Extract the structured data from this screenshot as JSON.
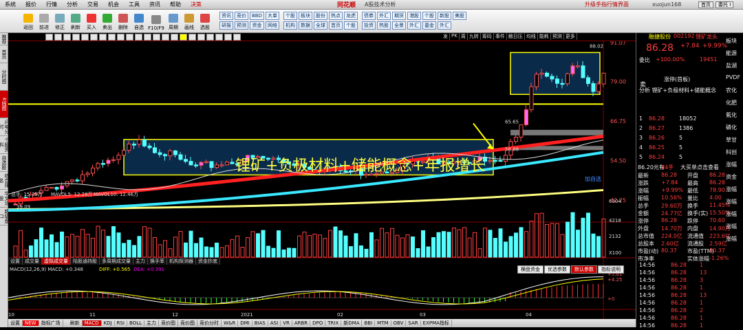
{
  "menu": {
    "items": [
      "系统",
      "报价",
      "行情",
      "分析",
      "交易",
      "机会",
      "工具",
      "资讯",
      "帮助",
      "决策"
    ],
    "brand": "同花顺",
    "doc": "A股技术分析",
    "upgrade": "升级手指行情界面",
    "user": "xuojun168",
    "right_btns": [
      "首页",
      "委托 I"
    ]
  },
  "toolbar": {
    "buttons": [
      "返回",
      "前进",
      "修正",
      "刷新",
      "买入",
      "卖出",
      "删除",
      "自选",
      "F10/F9",
      "周期",
      "画线",
      "选股"
    ],
    "g1": [
      "资讯",
      "竞价",
      "BBD",
      "大单",
      "研报",
      "预测",
      "资金",
      "网络"
    ],
    "g2": [
      "个股",
      "板块",
      "股份",
      "热点",
      "龙虎",
      "机构",
      "数据",
      "全球",
      "首页",
      "个股"
    ],
    "g3": [
      "债券",
      "外汇",
      "期货",
      "港股",
      "个股",
      "新股",
      "美股",
      "投资",
      "热股",
      "全景",
      "外汇",
      "基金",
      "外汇"
    ]
  },
  "sidebar": {
    "tabs": [
      "推荐",
      "首页",
      "分时图",
      "K线图",
      "闪电分时",
      "个股资料",
      "自选股",
      "综合排名",
      "牛叉诊股",
      "超级盘口"
    ],
    "active": 3
  },
  "chart_top": {
    "period_btns": [
      "发",
      "PK",
      "周",
      "九转",
      "筹码",
      "事件",
      "触日压",
      "均线",
      "能耗",
      "预测",
      "更多"
    ]
  },
  "chart_data": {
    "type": "candlestick",
    "x_ticks": [
      "10",
      "11",
      "12",
      "2021",
      "02",
      "03",
      "04"
    ],
    "y_ticks": [
      "91.07",
      "79.00",
      "66.75",
      "54.50",
      "42.25"
    ],
    "annotations": {
      "high": "88.02",
      "low": "39.09",
      "p1": "65.65",
      "p2": "56.86",
      "p3": "65.62",
      "p4": "84.55"
    },
    "volume": {
      "label": "总手: 15.35万",
      "ma5": "MAVOL5: 12.28万",
      "ma10": "MAVOL10: 12.46万",
      "ticks": [
        "6304",
        "4218",
        "2132",
        "X100"
      ]
    },
    "macd": {
      "label": "MACD(12,26,9)",
      "macd": "MACD: +0.348",
      "diff": "DIFF: +0.565",
      "dea": "DEA: +0.391",
      "ticks": [
        "+5.61",
        "+4.25",
        "+0"
      ]
    },
    "headline": "锂矿+负极材料+储能概念+年报增长",
    "badge": "加自选"
  },
  "vol_tabs": [
    "设置",
    "成交量",
    "虚拟成交量",
    "陆股通持股",
    "多周期成交量",
    "主力",
    "换手率",
    "机构探测器",
    "资金抄底"
  ],
  "vol_active": 2,
  "ind_tabs": [
    "横盘资金",
    "优选参数",
    "默认参数",
    "指标说明"
  ],
  "ind_active": 2,
  "bottom_tabs": [
    "设置",
    "NEW",
    "指标广场",
    "",
    "刷新",
    "MACD",
    "KDJ",
    "RSI",
    "BOLL",
    "主力",
    "竞价图",
    "竞价图",
    "竞价分时",
    "W&R",
    "DMI",
    "BIAS",
    "ASI",
    "VR",
    "ARBR",
    "DPO",
    "TRIX",
    "新DMA",
    "BBI",
    "MTM",
    "OBV",
    "SAR",
    "EXPMA指标"
  ],
  "bottom_active": 5,
  "quote": {
    "code": "融捷股份",
    "code_num": "002192",
    "tag": "锂矿龙头",
    "price": "86.28",
    "change": "+7.84",
    "pct": "+9.99%",
    "weibi": "委比",
    "weibi_val": "+100.00%",
    "weibi_n": "19451",
    "status": "涨停(首板)",
    "analysis": "分析 锂矿+负极材料+储能概念",
    "sells": [
      {
        "l": "卖",
        "p": "",
        "v": ""
      }
    ],
    "buys": [
      {
        "l": "1",
        "p": "86.28",
        "v": "18052"
      },
      {
        "l": "2",
        "p": "86.27",
        "v": "1386"
      },
      {
        "l": "3",
        "p": "86.26",
        "v": "5"
      },
      {
        "l": "4",
        "p": "86.25",
        "v": "5"
      },
      {
        "l": "5",
        "p": "86.24",
        "v": "5"
      }
    ],
    "big": "86.20元有",
    "big2": "84手",
    "big3": "大买单点击查看",
    "stats": [
      [
        "最新",
        "86.28",
        "开盘",
        "86.28"
      ],
      [
        "涨跌",
        "+7.84",
        "最高",
        "86.28"
      ],
      [
        "涨幅",
        "+9.99%",
        "最低",
        "78.90"
      ],
      [
        "振幅",
        "10.56%",
        "量比",
        "4.00"
      ],
      [
        "总手",
        "29.60万",
        "换手",
        "11.45%"
      ],
      [
        "金额",
        "24.77亿",
        "换手(实)",
        "15.50%"
      ],
      [
        "涨停",
        "86.28",
        "跌停",
        "70.60"
      ],
      [
        "外盘",
        "14.70万",
        "内盘",
        "14.90万"
      ],
      [
        "总市值",
        "224.0亿",
        "流通值",
        "223.6亿"
      ],
      [
        "总股本",
        "2.60亿",
        "流通股",
        "2.59亿"
      ],
      [
        "市盈(动)",
        "80.37",
        "市盈(TTM)",
        "80.37"
      ],
      [
        "市净率",
        "",
        "实体涨幅",
        "-1.26%"
      ]
    ],
    "ticks": [
      [
        "14:56",
        "86.28",
        "1"
      ],
      [
        "14:56",
        "86.28",
        "13"
      ],
      [
        "14:56",
        "86.28",
        "3"
      ],
      [
        "14:56",
        "86.28",
        "1"
      ],
      [
        "14:56",
        "86.28",
        "13"
      ],
      [
        "14:56",
        "86.28",
        "1"
      ],
      [
        "14:56",
        "86.28",
        "2"
      ],
      [
        "14:56",
        "86.28",
        "1"
      ],
      [
        "14:56",
        "86.28",
        "1"
      ]
    ],
    "far_right": [
      "板块",
      "能源",
      "盐湖",
      "PVDF",
      "农化",
      "化肥",
      "氟化",
      "磷化",
      "草甘",
      "科创",
      "涨幅",
      "资金",
      "涨幅",
      "涨幅",
      "涨幅",
      "涨幅",
      "涨幅"
    ]
  },
  "colors": {
    "up": "#ff3b3b",
    "down": "#00e0ff",
    "ma_red": "#ff2020",
    "ma_cyan": "#3ae8ff",
    "ma_yellow": "#ffff80",
    "box": "#ffff00"
  }
}
